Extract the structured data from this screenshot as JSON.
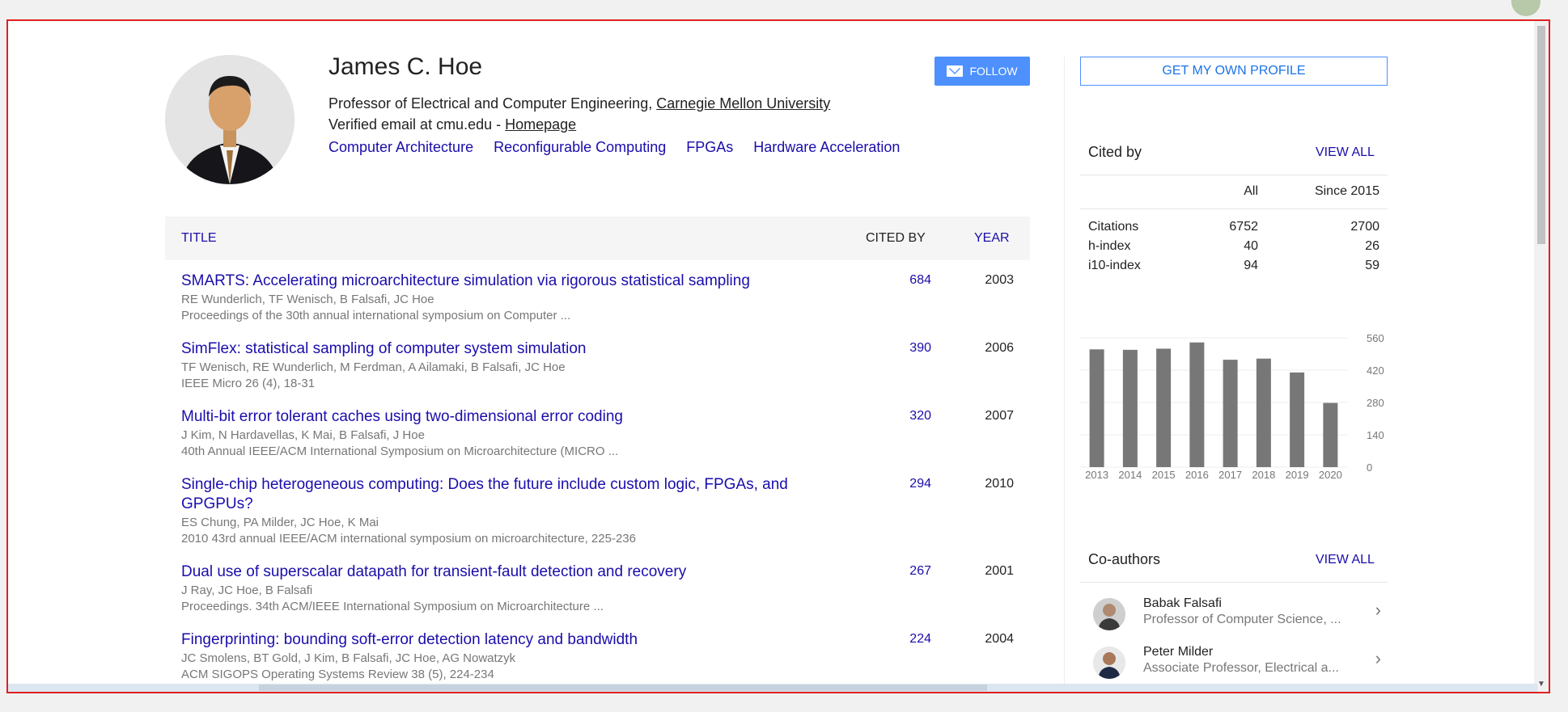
{
  "profile": {
    "name": "James C. Hoe",
    "affiliation_prefix": "Professor of Electrical and Computer Engineering,",
    "affiliation_link": "Carnegie Mellon University",
    "email_text": "Verified email at cmu.edu -",
    "homepage": "Homepage",
    "interests": [
      "Computer Architecture",
      "Reconfigurable Computing",
      "FPGAs",
      "Hardware Acceleration"
    ],
    "follow_label": "FOLLOW"
  },
  "table": {
    "col_title": "TITLE",
    "col_cited_by": "CITED BY",
    "col_year": "YEAR"
  },
  "publications": [
    {
      "title": "SMARTS: Accelerating microarchitecture simulation via rigorous statistical sampling",
      "authors": "RE Wunderlich, TF Wenisch, B Falsafi, JC Hoe",
      "venue": "Proceedings of the 30th annual international symposium on Computer ...",
      "cited_by": "684",
      "year": "2003"
    },
    {
      "title": "SimFlex: statistical sampling of computer system simulation",
      "authors": "TF Wenisch, RE Wunderlich, M Ferdman, A Ailamaki, B Falsafi, JC Hoe",
      "venue": "IEEE Micro 26 (4), 18-31",
      "cited_by": "390",
      "year": "2006"
    },
    {
      "title": "Multi-bit error tolerant caches using two-dimensional error coding",
      "authors": "J Kim, N Hardavellas, K Mai, B Falsafi, J Hoe",
      "venue": "40th Annual IEEE/ACM International Symposium on Microarchitecture (MICRO ...",
      "cited_by": "320",
      "year": "2007"
    },
    {
      "title": "Single-chip heterogeneous computing: Does the future include custom logic, FPGAs, and GPGPUs?",
      "authors": "ES Chung, PA Milder, JC Hoe, K Mai",
      "venue": "2010 43rd annual IEEE/ACM international symposium on microarchitecture, 225-236",
      "cited_by": "294",
      "year": "2010"
    },
    {
      "title": "Dual use of superscalar datapath for transient-fault detection and recovery",
      "authors": "J Ray, JC Hoe, B Falsafi",
      "venue": "Proceedings. 34th ACM/IEEE International Symposium on Microarchitecture ...",
      "cited_by": "267",
      "year": "2001"
    },
    {
      "title": "Fingerprinting: bounding soft-error detection latency and bandwidth",
      "authors": "JC Smolens, BT Gold, J Kim, B Falsafi, JC Hoe, AG Nowatzyk",
      "venue": "ACM SIGOPS Operating Systems Review 38 (5), 224-234",
      "cited_by": "224",
      "year": "2004"
    }
  ],
  "sidebar": {
    "own_profile_label": "GET MY OWN PROFILE",
    "cited_by_title": "Cited by",
    "view_all": "VIEW ALL",
    "col_all": "All",
    "col_since": "Since 2015",
    "metrics": [
      {
        "label": "Citations",
        "all": "6752",
        "since": "2700"
      },
      {
        "label": "h-index",
        "all": "40",
        "since": "26"
      },
      {
        "label": "i10-index",
        "all": "94",
        "since": "59"
      }
    ],
    "coauthors_title": "Co-authors",
    "coauthors": [
      {
        "name": "Babak Falsafi",
        "affiliation": "Professor of Computer Science, ..."
      },
      {
        "name": "Peter Milder",
        "affiliation": "Associate Professor, Electrical a..."
      }
    ]
  },
  "chart_data": {
    "type": "bar",
    "categories": [
      "2013",
      "2014",
      "2015",
      "2016",
      "2017",
      "2018",
      "2019",
      "2020"
    ],
    "values": [
      510,
      508,
      513,
      540,
      465,
      470,
      410,
      278
    ],
    "title": "",
    "xlabel": "",
    "ylabel": "",
    "ylim": [
      0,
      560
    ],
    "yticks": [
      "560",
      "420",
      "280",
      "140",
      "0"
    ],
    "bar_color": "#777777",
    "grid": true
  }
}
